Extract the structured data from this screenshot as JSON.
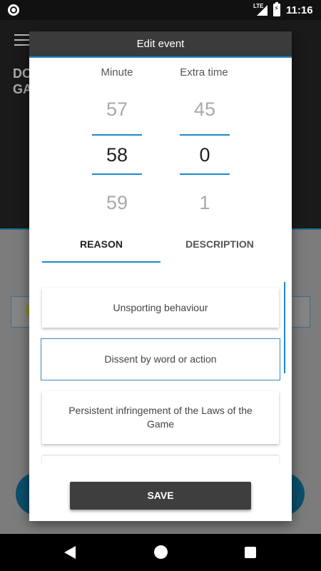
{
  "status_bar": {
    "network": "LTE",
    "time": "11:16"
  },
  "background": {
    "title_line1": "DO",
    "title_line2": "GA"
  },
  "dialog": {
    "title": "Edit event",
    "minute_label": "Minute",
    "extra_time_label": "Extra time",
    "minute_values": [
      "57",
      "58",
      "59"
    ],
    "extra_time_values": [
      "45",
      "0",
      "1"
    ],
    "selected_minute": "58",
    "selected_extra_time": "0",
    "tabs": [
      {
        "label": "REASON",
        "active": true
      },
      {
        "label": "DESCRIPTION",
        "active": false
      }
    ],
    "reasons": [
      {
        "label": "Unsporting behaviour",
        "selected": false
      },
      {
        "label": "Dissent by word or action",
        "selected": true
      },
      {
        "label": "Persistent infringement of the Laws of the Game",
        "selected": false
      }
    ],
    "save_label": "SAVE"
  },
  "colors": {
    "accent": "#1e88c8",
    "header": "#3b3b3b",
    "button": "#3e3e3e"
  }
}
